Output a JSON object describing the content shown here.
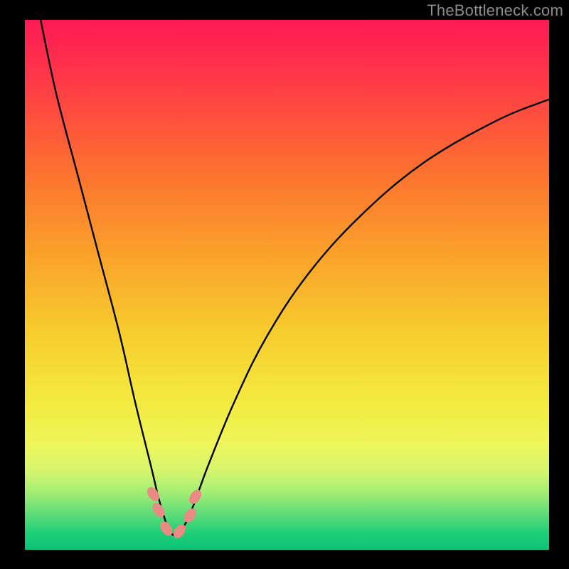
{
  "watermark": "TheBottleneck.com",
  "layout": {
    "outer_w": 800,
    "outer_h": 800,
    "inner_x": 35,
    "inner_y": 28,
    "inner_w": 737,
    "inner_h": 745
  },
  "gradient": {
    "stops": [
      {
        "pct": 0,
        "color": "#ff1a55"
      },
      {
        "pct": 12,
        "color": "#ff3b46"
      },
      {
        "pct": 28,
        "color": "#fd6f30"
      },
      {
        "pct": 45,
        "color": "#faa42a"
      },
      {
        "pct": 60,
        "color": "#f7cf2e"
      },
      {
        "pct": 72,
        "color": "#f3ea3f"
      },
      {
        "pct": 80,
        "color": "#eef65a"
      },
      {
        "pct": 85,
        "color": "#d6f56d"
      },
      {
        "pct": 89,
        "color": "#a6ee74"
      },
      {
        "pct": 93,
        "color": "#63dd78"
      },
      {
        "pct": 97,
        "color": "#1ccf78"
      },
      {
        "pct": 100,
        "color": "#0cc176"
      }
    ]
  },
  "chart_data": {
    "type": "line",
    "title": "",
    "xlabel": "",
    "ylabel": "",
    "xlim": [
      0,
      100
    ],
    "ylim": [
      0,
      100
    ],
    "note": "Axes are unlabeled; values are percentages of the plot area. y=100 is top (worst/red), y≈0 is bottom (best/green). The curve is |bottleneck%|-style with minimum near x≈28.",
    "series": [
      {
        "name": "bottleneck-curve",
        "color": "#000000",
        "x": [
          3,
          6,
          10,
          14,
          18,
          21,
          24,
          26,
          28,
          30,
          32,
          35,
          40,
          46,
          54,
          64,
          76,
          90,
          100
        ],
        "y": [
          100,
          86,
          71,
          56,
          41,
          28,
          16,
          8,
          3,
          4,
          8,
          16,
          28,
          40,
          52,
          63,
          73,
          81,
          85
        ]
      }
    ],
    "markers": {
      "name": "highlight-dots",
      "color": "#e98b82",
      "points": [
        {
          "x": 24.5,
          "y": 10.5
        },
        {
          "x": 25.5,
          "y": 7.5
        },
        {
          "x": 27.0,
          "y": 4.0
        },
        {
          "x": 29.5,
          "y": 3.5
        },
        {
          "x": 31.5,
          "y": 6.5
        },
        {
          "x": 32.5,
          "y": 10.0
        }
      ],
      "rx": 7,
      "ry": 11
    }
  }
}
